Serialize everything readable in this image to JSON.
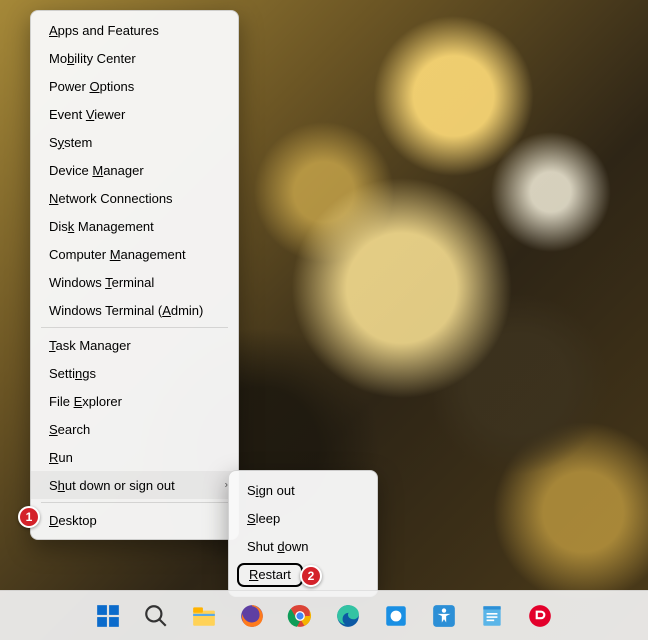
{
  "winx_menu": {
    "items": [
      {
        "label": "Apps and Features",
        "u": 0
      },
      {
        "label": "Mobility Center",
        "u": 2
      },
      {
        "label": "Power Options",
        "u": 6
      },
      {
        "label": "Event Viewer",
        "u": 6
      },
      {
        "label": "System",
        "u": 1
      },
      {
        "label": "Device Manager",
        "u": 7
      },
      {
        "label": "Network Connections",
        "u": 0
      },
      {
        "label": "Disk Management",
        "u": 3
      },
      {
        "label": "Computer Management",
        "u": 9
      },
      {
        "label": "Windows Terminal",
        "u": 8
      },
      {
        "label": "Windows Terminal (Admin)",
        "u": 18
      }
    ],
    "items2": [
      {
        "label": "Task Manager",
        "u": 0
      },
      {
        "label": "Settings",
        "u": 5
      },
      {
        "label": "File Explorer",
        "u": 5
      },
      {
        "label": "Search",
        "u": 0
      },
      {
        "label": "Run",
        "u": 0
      },
      {
        "label": "Shut down or sign out",
        "u": 1,
        "submenu": true
      }
    ],
    "items3": [
      {
        "label": "Desktop",
        "u": 0
      }
    ]
  },
  "submenu": {
    "items": [
      {
        "label": "Sign out",
        "u": 1
      },
      {
        "label": "Sleep",
        "u": 0
      },
      {
        "label": "Shut down",
        "u": 5
      },
      {
        "label": "Restart",
        "u": 0,
        "highlight": true
      }
    ]
  },
  "annotations": {
    "badge1": "1",
    "badge2": "2"
  },
  "taskbar": {
    "icons": [
      "start-icon",
      "search-icon",
      "file-explorer-icon",
      "firefox-icon",
      "chrome-icon",
      "edge-icon",
      "generic-blue-icon",
      "accessibility-icon",
      "notes-icon",
      "red-app-icon"
    ]
  }
}
